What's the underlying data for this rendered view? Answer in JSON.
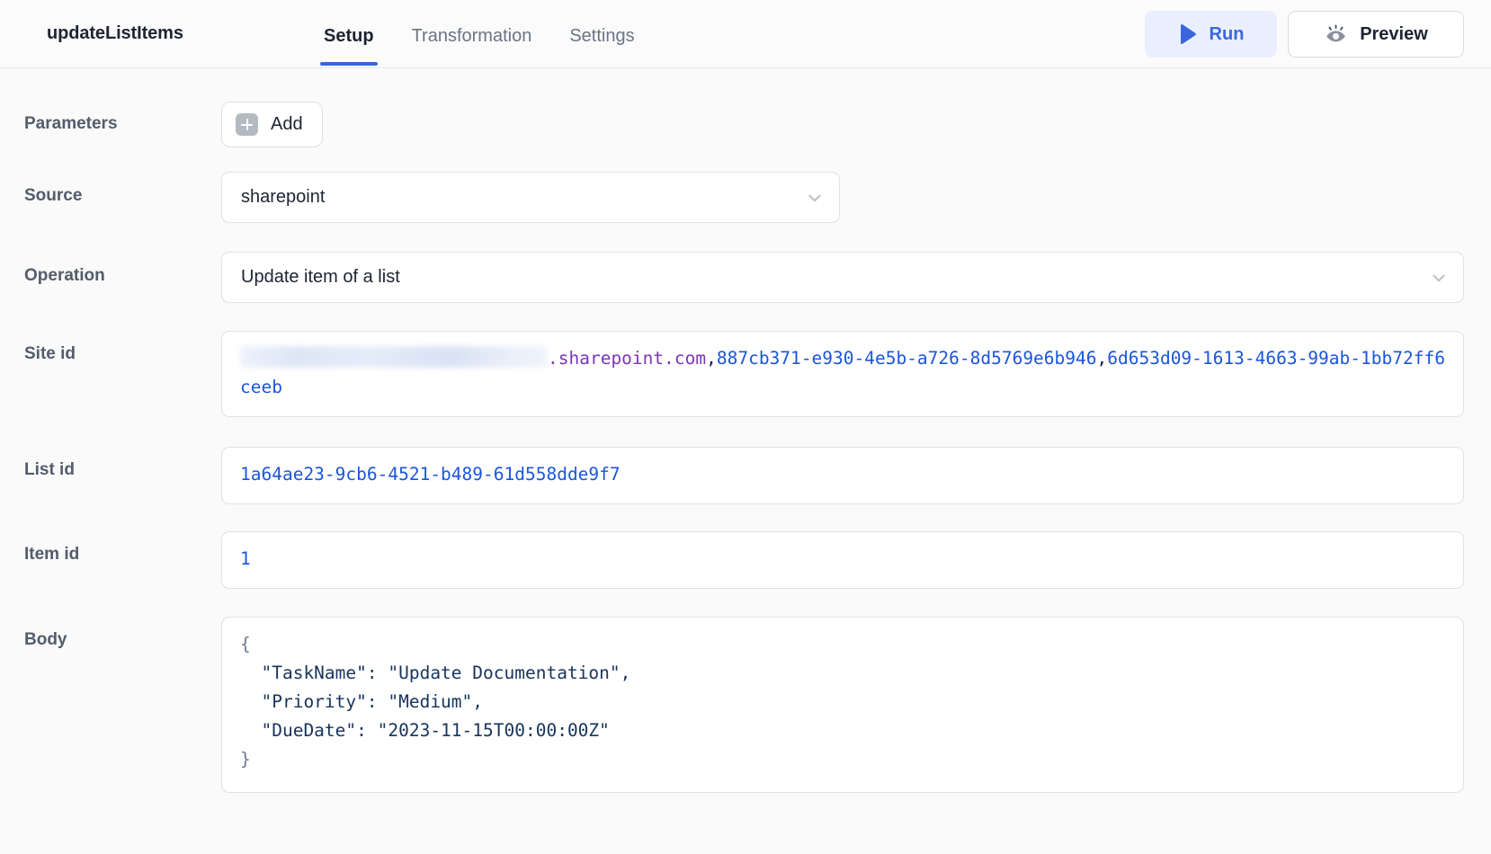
{
  "header": {
    "node_title": "updateListItems",
    "tabs": [
      {
        "label": "Setup",
        "active": true
      },
      {
        "label": "Transformation",
        "active": false
      },
      {
        "label": "Settings",
        "active": false
      }
    ],
    "run_label": "Run",
    "preview_label": "Preview",
    "accent_color": "#3b66db",
    "run_bg_color": "#eaefff"
  },
  "form": {
    "parameters": {
      "label": "Parameters",
      "add_label": "Add"
    },
    "source": {
      "label": "Source",
      "value": "sharepoint"
    },
    "operation": {
      "label": "Operation",
      "value": "Update item of a list"
    },
    "site_id": {
      "label": "Site id",
      "redacted_prefix": true,
      "domain_suffix": ".sharepoint.com",
      "separator": ",",
      "guid_1": "887cb371-e930-4e5b-a726-8d5769e6b946",
      "guid_2": "6d653d09-1613-4663-99ab-1bb72ff6ceeb"
    },
    "list_id": {
      "label": "List id",
      "value": "1a64ae23-9cb6-4521-b489-61d558dde9f7"
    },
    "item_id": {
      "label": "Item id",
      "value": "1"
    },
    "body": {
      "label": "Body",
      "open_brace": "{",
      "lines": [
        "  \"TaskName\": \"Update Documentation\",",
        "  \"Priority\": \"Medium\",",
        "  \"DueDate\": \"2023-11-15T00:00:00Z\""
      ],
      "close_brace": "}",
      "text": "  \"TaskName\": \"Update Documentation\",\n  \"Priority\": \"Medium\",\n  \"DueDate\": \"2023-11-15T00:00:00Z\""
    }
  },
  "icons": {
    "play": "play-icon",
    "eye": "eye-icon",
    "chevron": "chevron-down-icon",
    "plus": "plus-icon"
  }
}
